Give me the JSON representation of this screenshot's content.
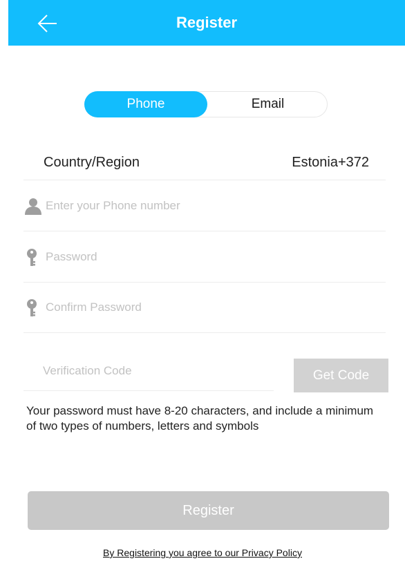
{
  "colors": {
    "accent": "#12bdfd",
    "disabled_button": "#d2d2d2",
    "register_button": "#c8c8c8",
    "placeholder": "#c2c2c2",
    "icon_gray": "#9e9e9e"
  },
  "header": {
    "title": "Register",
    "back_icon": "arrow-left-icon"
  },
  "tabs": {
    "phone": "Phone",
    "email": "Email",
    "active": "Phone"
  },
  "country": {
    "label": "Country/Region",
    "value": "Estonia+372"
  },
  "fields": {
    "phone": {
      "placeholder": "Enter your Phone number",
      "icon": "user-icon"
    },
    "password": {
      "placeholder": "Password",
      "icon": "key-icon"
    },
    "confirm_password": {
      "placeholder": "Confirm Password",
      "icon": "key-icon"
    },
    "verification_code": {
      "placeholder": "Verification Code"
    }
  },
  "get_code_label": "Get Code",
  "password_hint": "Your password must have 8-20 characters, and include a minimum of two types of numbers, letters and symbols",
  "register_label": "Register",
  "privacy_text": "By Registering you agree to our Privacy Policy"
}
